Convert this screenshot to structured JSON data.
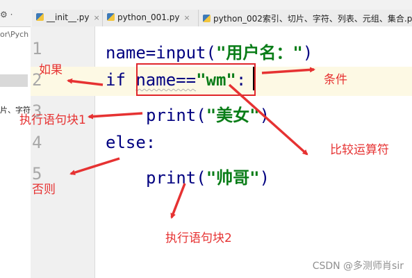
{
  "tabs": {
    "settings_glyph": "⚙ ·",
    "items": [
      {
        "label": "__init__.py",
        "icon": "python-file-icon",
        "close": "×"
      },
      {
        "label": "python_001.py",
        "icon": "python-file-icon",
        "close": "×"
      },
      {
        "label": "python_002索引、切片、字符、列表、元组、集合.py",
        "icon": "python-file-icon"
      }
    ]
  },
  "project_panel": {
    "path_fragment": "or\\Pych",
    "item_fragment": "片、字符"
  },
  "editor": {
    "line_numbers": [
      "1",
      "2",
      "3",
      "4",
      "5"
    ],
    "lines": [
      {
        "a": "name=input(",
        "s": "\"用户名：\"",
        "b": ")"
      },
      {
        "kw": "if",
        "a": "name==",
        "s": "\"wm\"",
        "b": ":"
      },
      {
        "a": "print(",
        "s": "\"美女\"",
        "b": ")"
      },
      {
        "kw": "else",
        "b": ":"
      },
      {
        "a": "print(",
        "s": "\"帅哥\"",
        "b": ")"
      }
    ]
  },
  "annotations": {
    "if_label": "如果",
    "condition_label": "条件",
    "block1_label": "执行语句块1",
    "compare_label": "比较运算符",
    "else_label": "否则",
    "block2_label": "执行语句块2",
    "color": "#e63232"
  },
  "watermark": "CSDN @多测师肖sir"
}
